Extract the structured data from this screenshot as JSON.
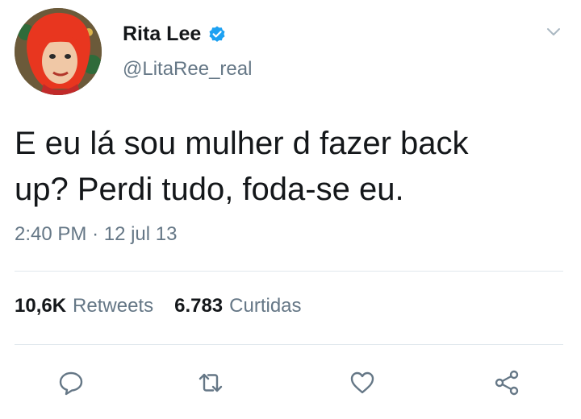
{
  "user": {
    "display_name": "Rita Lee",
    "handle": "@LitaRee_real",
    "verified": true
  },
  "tweet": {
    "text_line1": "E eu lá sou mulher d fazer back",
    "text_line2": "up? Perdi tudo, foda-se eu.",
    "time": "2:40 PM",
    "separator": "·",
    "date": "12 jul 13"
  },
  "stats": {
    "retweets_count": "10,6K",
    "retweets_label": "Retweets",
    "likes_count": "6.783",
    "likes_label": "Curtidas"
  },
  "icons": [
    "avatar",
    "verified-badge-icon",
    "chevron-down-icon",
    "reply-icon",
    "retweet-icon",
    "like-icon",
    "share-icon"
  ],
  "colors": {
    "text": "#14171a",
    "secondary": "#657786",
    "verified": "#1da1f2",
    "divider": "#e1e8ed"
  }
}
